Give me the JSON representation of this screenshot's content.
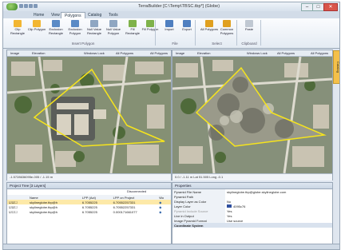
{
  "window": {
    "title": "TerraBuilder [C:\\Temp\\TBSC.tbp*] (Globe)"
  },
  "tabs": [
    {
      "label": "Home"
    },
    {
      "label": "View"
    },
    {
      "label": "Polygons",
      "active": true
    },
    {
      "label": "Catalog"
    },
    {
      "label": "Tools"
    }
  ],
  "ribbon": {
    "buttons": [
      {
        "label": "Clip Rectangle",
        "icon": "clip-rectangle-icon",
        "color": "#f2b632"
      },
      {
        "label": "Clip Polygon",
        "icon": "clip-polygon-icon",
        "color": "#f2b632"
      },
      {
        "label": "Exclusion Rectangle",
        "icon": "exclusion-rectangle-icon",
        "color": "#5a8ac6"
      },
      {
        "label": "Exclusion Polygon",
        "icon": "exclusion-polygon-icon",
        "color": "#5a8ac6"
      },
      {
        "label": "Null Value Rectangle",
        "icon": "null-value-rectangle-icon",
        "color": "#8fa6c2"
      },
      {
        "label": "Null Value Polygon",
        "icon": "null-value-polygon-icon",
        "color": "#8fa6c2"
      },
      {
        "label": "Fill Rectangle",
        "icon": "fill-rectangle-icon",
        "color": "#7fb24a"
      },
      {
        "label": "Fill Polygon",
        "icon": "fill-polygon-icon",
        "color": "#7fb24a"
      },
      {
        "label": "Import",
        "icon": "import-icon",
        "color": "#4f7fc0"
      },
      {
        "label": "Export",
        "icon": "export-icon",
        "color": "#4f7fc0"
      },
      {
        "label": "All Polygons",
        "icon": "all-polygons-icon",
        "color": "#e0a020"
      },
      {
        "label": "Common Polygons",
        "icon": "common-polygons-icon",
        "color": "#e0a020"
      },
      {
        "label": "Paste",
        "icon": "paste-icon",
        "color": "#c0c8d2"
      }
    ],
    "groups": [
      "Insert Polygon",
      "File",
      "Select",
      "Clipboard"
    ]
  },
  "left_view": {
    "toolbar": [
      "Image",
      "Elevation",
      "Windows Lock",
      "All Polygons",
      "All Polygons"
    ],
    "coordinates": "-1.5728636095e-005 / -1.15 m"
  },
  "right_view": {
    "toolbar": [
      "Image",
      "Elevation",
      "Windows Lock",
      "All Polygons",
      "All Polygons"
    ],
    "coordinates": "0.0 / -1.11 m  Lat 51.505 Long -0.1"
  },
  "side_tab": {
    "label": "Catalog"
  },
  "project_tree": {
    "title": "Project Tree [3 Layers]",
    "disconnected_label": "Disconnected",
    "columns": [
      "Name",
      "LPP (Act)",
      "LPP on Project",
      "Wo"
    ],
    "rows": [
      {
        "name": "skylineglobe.tbp@h",
        "lpp_act": "6.7055225",
        "lpp_project": "6.70552257331"
      },
      {
        "name": "skylineglobe.tbp@h",
        "lpp_act": "6.7055225",
        "lpp_project": "6.70552257331"
      },
      {
        "name": "skylineglobe.tbp@h",
        "lpp_act": "6.7055225",
        "lpp_project": "0.000171661077"
      }
    ]
  },
  "properties": {
    "title": "Properties",
    "rows": [
      {
        "key": "Pyramid File Name",
        "value": "skylineglobe.tbp@globe.skylineglobe.com"
      },
      {
        "key": "Pyramid Path",
        "value": ""
      },
      {
        "key": "Display Layer as Color",
        "value": "No"
      },
      {
        "key": "Layer Color",
        "value": "4095c76"
      },
      {
        "key": "Pyramid Include Source",
        "value": "Yes"
      },
      {
        "key": "Live in Output",
        "value": "Yes"
      },
      {
        "key": "Image Pyramid Format",
        "value": "Use source"
      }
    ],
    "section": "Coordinate System"
  },
  "colors": {
    "polygon_outline": "#f6e41c",
    "accent": "#2f63a8"
  }
}
